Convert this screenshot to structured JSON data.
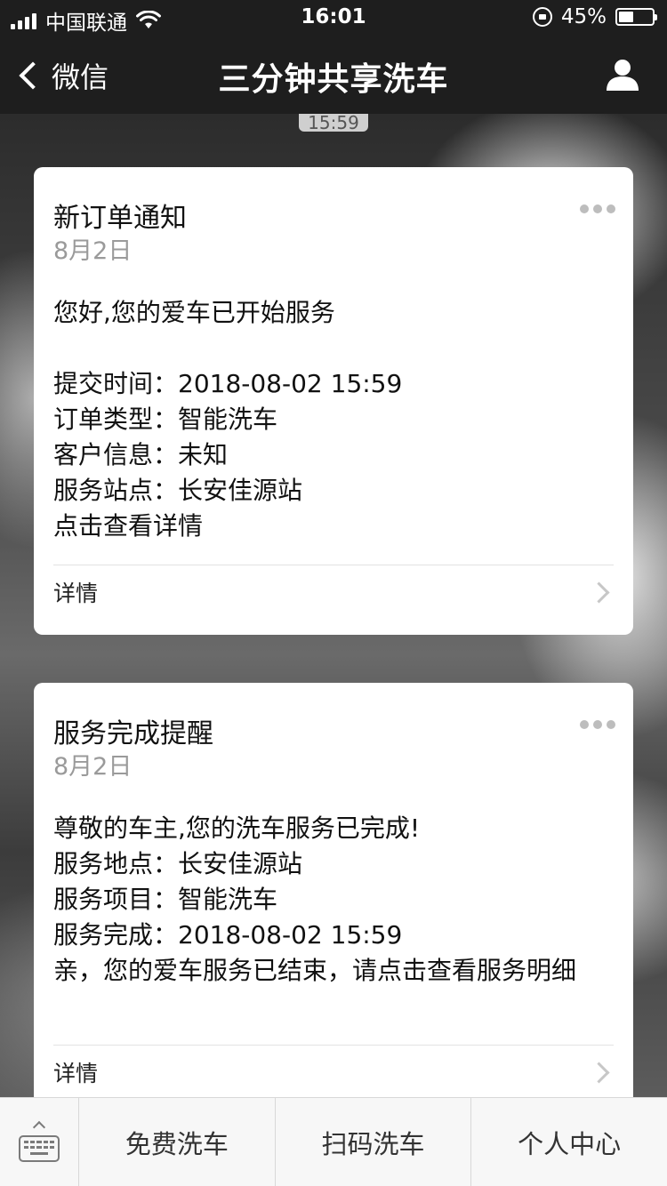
{
  "status_bar": {
    "carrier": "中国联通",
    "time": "16:01",
    "battery_percent": "45%",
    "battery_level": 0.45
  },
  "nav": {
    "back_label": "微信",
    "title": "三分钟共享洗车"
  },
  "chat": {
    "time_bubble": "15:59"
  },
  "messages": [
    {
      "title": "新订单通知",
      "date": "8月2日",
      "greeting": "您好,您的爱车已开始服务",
      "lines": [
        "提交时间：2018-08-02 15:59",
        "订单类型：智能洗车",
        "客户信息：未知",
        "服务站点：长安佳源站",
        "点击查看详情"
      ],
      "detail_label": "详情"
    },
    {
      "title": "服务完成提醒",
      "date": "8月2日",
      "lines": [
        "尊敬的车主,您的洗车服务已完成!",
        "服务地点：长安佳源站",
        "服务项目：智能洗车",
        "服务完成：2018-08-02 15:59",
        "亲，您的爱车服务已结束，请点击查看服务明细"
      ],
      "detail_label": "详情"
    }
  ],
  "menu": {
    "items": [
      "免费洗车",
      "扫码洗车",
      "个人中心"
    ]
  }
}
